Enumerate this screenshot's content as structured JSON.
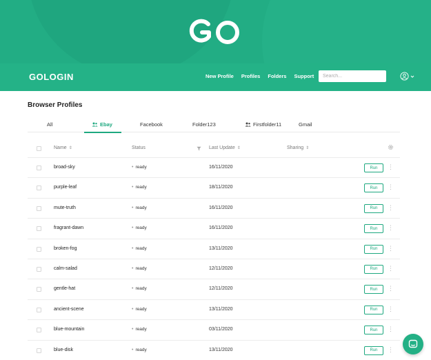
{
  "hero": {
    "logo_text": "GO"
  },
  "nav": {
    "brand": "GOLOGIN",
    "links": [
      "New Profile",
      "Profiles",
      "Folders",
      "Support"
    ],
    "search_placeholder": "Search..."
  },
  "page": {
    "title": "Browser Profiles"
  },
  "tabs": [
    {
      "label": "All",
      "icon": null,
      "active": false
    },
    {
      "label": "Ebay",
      "icon": "users-icon",
      "active": true
    },
    {
      "label": "Facebook",
      "icon": null,
      "active": false
    },
    {
      "label": "Folder123",
      "icon": null,
      "active": false
    },
    {
      "label": "Firstfolder11",
      "icon": "users-icon",
      "active": false
    },
    {
      "label": "Gmail",
      "icon": null,
      "active": false
    }
  ],
  "table": {
    "columns": {
      "name": "Name",
      "status": "Status",
      "last_update": "Last Update",
      "sharing": "Sharing"
    },
    "run_label": "Run",
    "rows": [
      {
        "name": "broad-sky",
        "status": "ready",
        "last_update": "16/11/2020"
      },
      {
        "name": "purple-leaf",
        "status": "ready",
        "last_update": "18/11/2020"
      },
      {
        "name": "mute-truth",
        "status": "ready",
        "last_update": "16/11/2020"
      },
      {
        "name": "fragrant-dawn",
        "status": "ready",
        "last_update": "16/11/2020"
      },
      {
        "name": "broken-fog",
        "status": "ready",
        "last_update": "13/11/2020"
      },
      {
        "name": "calm-salad",
        "status": "ready",
        "last_update": "12/11/2020"
      },
      {
        "name": "gentle-hat",
        "status": "ready",
        "last_update": "12/11/2020"
      },
      {
        "name": "ancient-scene",
        "status": "ready",
        "last_update": "13/11/2020"
      },
      {
        "name": "blue-mountain",
        "status": "ready",
        "last_update": "03/11/2020"
      },
      {
        "name": "blue-disk",
        "status": "ready",
        "last_update": "13/11/2020"
      }
    ]
  },
  "colors": {
    "brand_green": "#24b287",
    "accent": "#1da87f"
  }
}
